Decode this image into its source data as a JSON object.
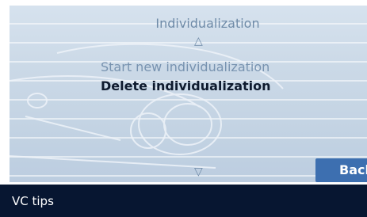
{
  "menu": {
    "title": "Individualization",
    "items": [
      {
        "label": "Start new individualization",
        "selected": false
      },
      {
        "label": "Delete individualization",
        "selected": true
      }
    ],
    "scroll_up_icon": "triangle-up-icon",
    "scroll_down_icon": "triangle-down-icon"
  },
  "actions": {
    "back_label": "Back"
  },
  "status_bar": {
    "text": "VC tips"
  },
  "colors": {
    "display_background": "#cbd9e7",
    "title_text": "#6f8ba8",
    "selected_text": "#0e1a2e",
    "unselected_text": "#7893b0",
    "back_button": "#3d6fb0",
    "status_bar": "#071631"
  }
}
